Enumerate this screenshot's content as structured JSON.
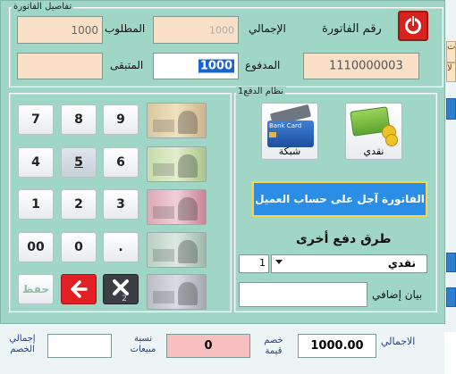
{
  "invoice_details": {
    "legend": "تفاصيل الفاتورة",
    "required_label": "المطلوب",
    "required_value": "1000",
    "total_label": "الإجمالي",
    "total_value": "1000",
    "invoice_no_label": "رقم الفاتورة",
    "remaining_label": "المتبقى",
    "remaining_value": "",
    "paid_label": "المدفوع",
    "paid_value": "1000",
    "invoice_no_value": "1110000003"
  },
  "keypad": {
    "keys": [
      "7",
      "8",
      "9",
      "4",
      "5",
      "6",
      "1",
      "2",
      "3",
      "00",
      "0",
      "."
    ],
    "save_label": "حفظ",
    "clear_badge": "2"
  },
  "payment": {
    "legend": "نظام الدفع1",
    "card_label": "شبكة",
    "card_brand": "Bank Card",
    "cash_label": "نقدي",
    "deferred_label": "الفاتورة آجل على حساب العميل",
    "other_methods_label": "طرق دفع أخرى",
    "other_method_qty": "1",
    "other_method_value": "نقدي",
    "extra_note_label": "بيان إضافي",
    "extra_note_value": ""
  },
  "footer": {
    "total_label": "الاجمالي",
    "total_value": "1000.00",
    "discount_value_label_1": "خصم",
    "discount_value_label_2": "قيمة",
    "discount_value": "0",
    "discount_rate_label_1": "نسبة",
    "discount_rate_label_2": "مبيعات",
    "discount_rate_value": "",
    "total_discount_label_1": "إجمالي",
    "total_discount_label_2": "الخصم"
  },
  "side_panel": {
    "tile_1": "ت",
    "tile_2": "لا"
  },
  "colors": {
    "dialog_bg": "#9fd6c6",
    "field_peach": "#fbe0c8",
    "deferred_btn": "#2a8ee6",
    "power_btn": "#d6231e"
  }
}
